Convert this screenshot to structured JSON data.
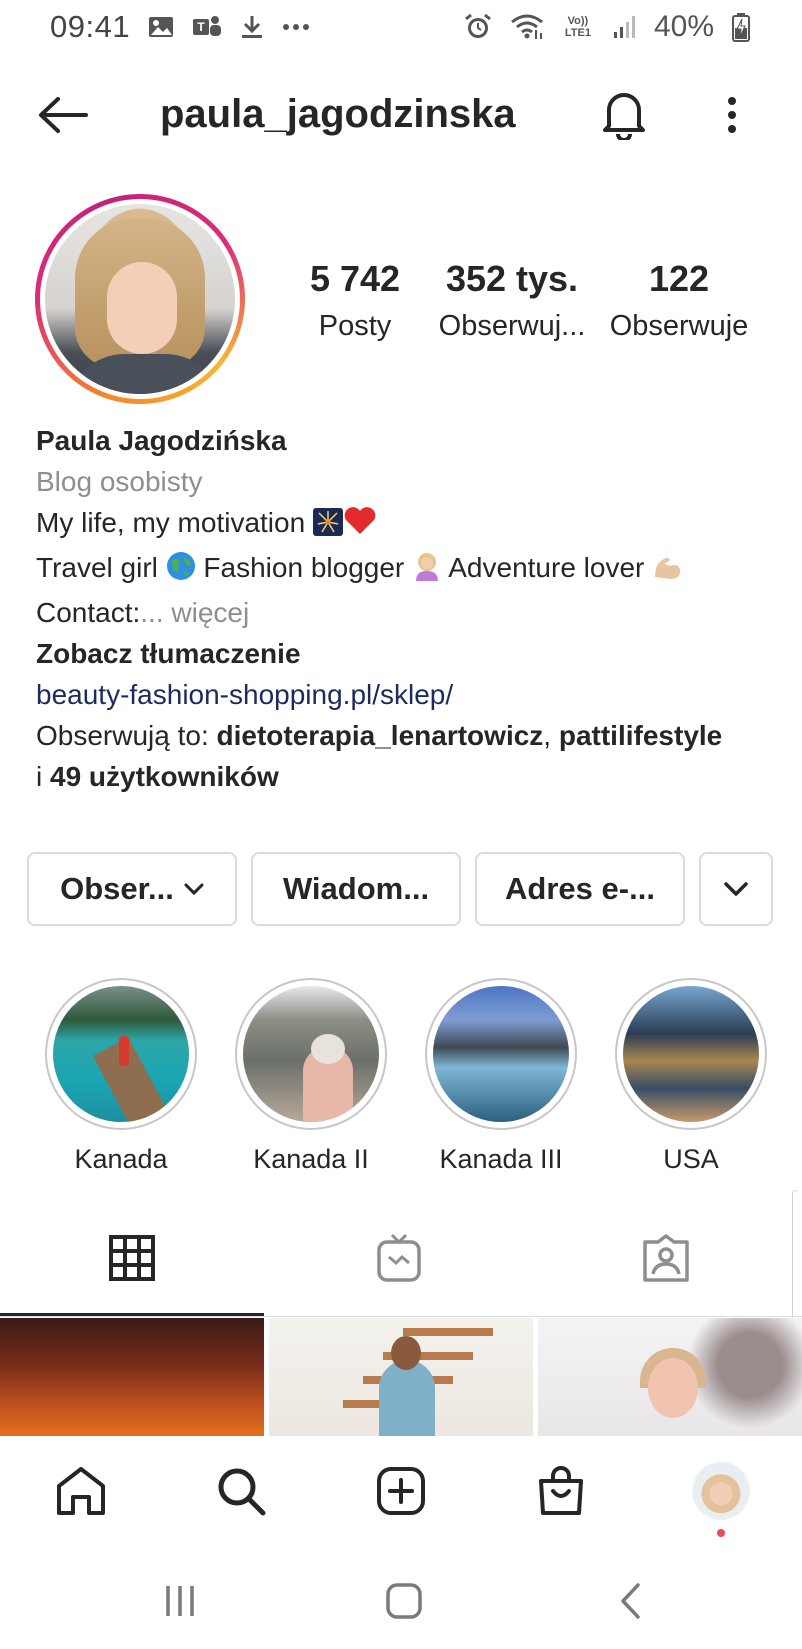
{
  "status_bar": {
    "time": "09:41",
    "network_label": "Vo)) LTE1",
    "battery": "40%"
  },
  "header": {
    "username": "paula_jagodzinska"
  },
  "profile": {
    "stats": [
      {
        "value": "5 742",
        "label": "Posty"
      },
      {
        "value": "352 tys.",
        "label": "Obserwuj..."
      },
      {
        "value": "122",
        "label": "Obserwuje"
      }
    ],
    "bio": {
      "name": "Paula Jagodzińska",
      "category": "Blog osobisty",
      "line1": "My life, my motivation ",
      "line2_a": "Travel girl ",
      "line2_b": " Fashion blogger ",
      "line2_c": " Adventure lover ",
      "contact": "Contact:",
      "more": "... więcej",
      "translate": "Zobacz tłumaczenie",
      "link": "beauty-fashion-shopping.pl/sklep/",
      "followed_prefix": "Obserwują to: ",
      "followed_user1": "dietoterapia_lenartowicz",
      "followed_sep": ", ",
      "followed_user2": "pattilifestyle",
      "followed_and": "i ",
      "followed_count": "49 użytkowników"
    }
  },
  "actions": {
    "follow": "Obser...",
    "message": "Wiadom...",
    "email": "Adres e-..."
  },
  "highlights": [
    {
      "label": "Kanada"
    },
    {
      "label": "Kanada II"
    },
    {
      "label": "Kanada III"
    },
    {
      "label": "USA"
    }
  ],
  "tabs": [
    "grid-icon",
    "igtv-icon",
    "tagged-icon"
  ],
  "bottom_nav": [
    "home-icon",
    "search-icon",
    "add-post-icon",
    "shop-icon",
    "profile-avatar"
  ],
  "colors": {
    "link": "#1c2b5e",
    "secondary_text": "#8e8e8e",
    "notification_dot": "#ed4956"
  }
}
